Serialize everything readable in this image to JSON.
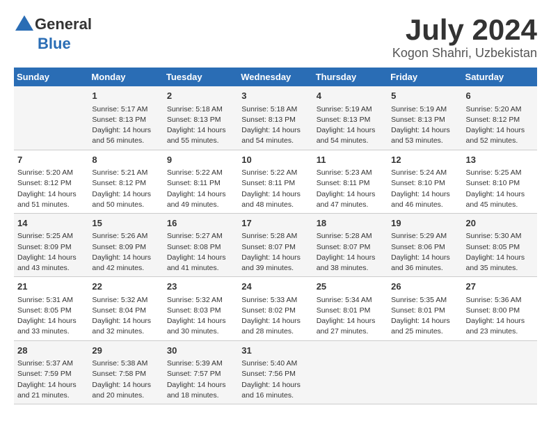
{
  "logo": {
    "general": "General",
    "blue": "Blue"
  },
  "title": "July 2024",
  "location": "Kogon Shahri, Uzbekistan",
  "days_of_week": [
    "Sunday",
    "Monday",
    "Tuesday",
    "Wednesday",
    "Thursday",
    "Friday",
    "Saturday"
  ],
  "weeks": [
    [
      {
        "day": "",
        "sunrise": "",
        "sunset": "",
        "daylight": ""
      },
      {
        "day": "1",
        "sunrise": "Sunrise: 5:17 AM",
        "sunset": "Sunset: 8:13 PM",
        "daylight": "Daylight: 14 hours and 56 minutes."
      },
      {
        "day": "2",
        "sunrise": "Sunrise: 5:18 AM",
        "sunset": "Sunset: 8:13 PM",
        "daylight": "Daylight: 14 hours and 55 minutes."
      },
      {
        "day": "3",
        "sunrise": "Sunrise: 5:18 AM",
        "sunset": "Sunset: 8:13 PM",
        "daylight": "Daylight: 14 hours and 54 minutes."
      },
      {
        "day": "4",
        "sunrise": "Sunrise: 5:19 AM",
        "sunset": "Sunset: 8:13 PM",
        "daylight": "Daylight: 14 hours and 54 minutes."
      },
      {
        "day": "5",
        "sunrise": "Sunrise: 5:19 AM",
        "sunset": "Sunset: 8:13 PM",
        "daylight": "Daylight: 14 hours and 53 minutes."
      },
      {
        "day": "6",
        "sunrise": "Sunrise: 5:20 AM",
        "sunset": "Sunset: 8:12 PM",
        "daylight": "Daylight: 14 hours and 52 minutes."
      }
    ],
    [
      {
        "day": "7",
        "sunrise": "",
        "sunset": "",
        "daylight": ""
      },
      {
        "day": "8",
        "sunrise": "Sunrise: 5:21 AM",
        "sunset": "Sunset: 8:12 PM",
        "daylight": "Daylight: 14 hours and 50 minutes."
      },
      {
        "day": "9",
        "sunrise": "Sunrise: 5:22 AM",
        "sunset": "Sunset: 8:11 PM",
        "daylight": "Daylight: 14 hours and 49 minutes."
      },
      {
        "day": "10",
        "sunrise": "Sunrise: 5:22 AM",
        "sunset": "Sunset: 8:11 PM",
        "daylight": "Daylight: 14 hours and 48 minutes."
      },
      {
        "day": "11",
        "sunrise": "Sunrise: 5:23 AM",
        "sunset": "Sunset: 8:11 PM",
        "daylight": "Daylight: 14 hours and 47 minutes."
      },
      {
        "day": "12",
        "sunrise": "Sunrise: 5:24 AM",
        "sunset": "Sunset: 8:10 PM",
        "daylight": "Daylight: 14 hours and 46 minutes."
      },
      {
        "day": "13",
        "sunrise": "Sunrise: 5:25 AM",
        "sunset": "Sunset: 8:10 PM",
        "daylight": "Daylight: 14 hours and 45 minutes."
      }
    ],
    [
      {
        "day": "14",
        "sunrise": "",
        "sunset": "",
        "daylight": ""
      },
      {
        "day": "15",
        "sunrise": "Sunrise: 5:26 AM",
        "sunset": "Sunset: 8:09 PM",
        "daylight": "Daylight: 14 hours and 42 minutes."
      },
      {
        "day": "16",
        "sunrise": "Sunrise: 5:27 AM",
        "sunset": "Sunset: 8:08 PM",
        "daylight": "Daylight: 14 hours and 41 minutes."
      },
      {
        "day": "17",
        "sunrise": "Sunrise: 5:28 AM",
        "sunset": "Sunset: 8:07 PM",
        "daylight": "Daylight: 14 hours and 39 minutes."
      },
      {
        "day": "18",
        "sunrise": "Sunrise: 5:28 AM",
        "sunset": "Sunset: 8:07 PM",
        "daylight": "Daylight: 14 hours and 38 minutes."
      },
      {
        "day": "19",
        "sunrise": "Sunrise: 5:29 AM",
        "sunset": "Sunset: 8:06 PM",
        "daylight": "Daylight: 14 hours and 36 minutes."
      },
      {
        "day": "20",
        "sunrise": "Sunrise: 5:30 AM",
        "sunset": "Sunset: 8:05 PM",
        "daylight": "Daylight: 14 hours and 35 minutes."
      }
    ],
    [
      {
        "day": "21",
        "sunrise": "",
        "sunset": "",
        "daylight": ""
      },
      {
        "day": "22",
        "sunrise": "Sunrise: 5:32 AM",
        "sunset": "Sunset: 8:04 PM",
        "daylight": "Daylight: 14 hours and 32 minutes."
      },
      {
        "day": "23",
        "sunrise": "Sunrise: 5:32 AM",
        "sunset": "Sunset: 8:03 PM",
        "daylight": "Daylight: 14 hours and 30 minutes."
      },
      {
        "day": "24",
        "sunrise": "Sunrise: 5:33 AM",
        "sunset": "Sunset: 8:02 PM",
        "daylight": "Daylight: 14 hours and 28 minutes."
      },
      {
        "day": "25",
        "sunrise": "Sunrise: 5:34 AM",
        "sunset": "Sunset: 8:01 PM",
        "daylight": "Daylight: 14 hours and 27 minutes."
      },
      {
        "day": "26",
        "sunrise": "Sunrise: 5:35 AM",
        "sunset": "Sunset: 8:01 PM",
        "daylight": "Daylight: 14 hours and 25 minutes."
      },
      {
        "day": "27",
        "sunrise": "Sunrise: 5:36 AM",
        "sunset": "Sunset: 8:00 PM",
        "daylight": "Daylight: 14 hours and 23 minutes."
      }
    ],
    [
      {
        "day": "28",
        "sunrise": "",
        "sunset": "",
        "daylight": ""
      },
      {
        "day": "29",
        "sunrise": "Sunrise: 5:38 AM",
        "sunset": "Sunset: 7:58 PM",
        "daylight": "Daylight: 14 hours and 20 minutes."
      },
      {
        "day": "30",
        "sunrise": "Sunrise: 5:39 AM",
        "sunset": "Sunset: 7:57 PM",
        "daylight": "Daylight: 14 hours and 18 minutes."
      },
      {
        "day": "31",
        "sunrise": "Sunrise: 5:40 AM",
        "sunset": "Sunset: 7:56 PM",
        "daylight": "Daylight: 14 hours and 16 minutes."
      },
      {
        "day": "",
        "sunrise": "",
        "sunset": "",
        "daylight": ""
      },
      {
        "day": "",
        "sunrise": "",
        "sunset": "",
        "daylight": ""
      },
      {
        "day": "",
        "sunrise": "",
        "sunset": "",
        "daylight": ""
      }
    ]
  ],
  "week1_special": [
    {
      "day": "7",
      "sunrise": "Sunrise: 5:20 AM",
      "sunset": "Sunset: 8:12 PM",
      "daylight": "Daylight: 14 hours and 51 minutes."
    }
  ],
  "week3_special": [
    {
      "day": "14",
      "sunrise": "Sunrise: 5:25 AM",
      "sunset": "Sunset: 8:09 PM",
      "daylight": "Daylight: 14 hours and 43 minutes."
    }
  ],
  "week4_special": [
    {
      "day": "21",
      "sunrise": "Sunrise: 5:31 AM",
      "sunset": "Sunset: 8:05 PM",
      "daylight": "Daylight: 14 hours and 33 minutes."
    }
  ],
  "week5_special": [
    {
      "day": "28",
      "sunrise": "Sunrise: 5:37 AM",
      "sunset": "Sunset: 7:59 PM",
      "daylight": "Daylight: 14 hours and 21 minutes."
    }
  ]
}
